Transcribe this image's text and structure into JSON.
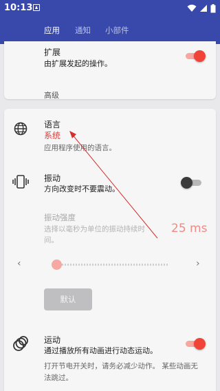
{
  "status_bar": {
    "time": "10:13",
    "icons": [
      "app-notification-icon",
      "wifi-icon",
      "signal-icon",
      "battery-icon"
    ]
  },
  "tabs": [
    {
      "label": "应用",
      "active": true
    },
    {
      "label": "通知",
      "active": false
    },
    {
      "label": "小部件",
      "active": false
    }
  ],
  "extension": {
    "title": "扩展",
    "summary": "由扩展发起的操作。",
    "toggle_on": true
  },
  "section_header": "高级",
  "language": {
    "icon": "globe-icon",
    "title": "语言",
    "value": "系统",
    "summary": "应用程序使用的语言。"
  },
  "vibration": {
    "icon": "vibration-icon",
    "title": "振动",
    "summary": "方向改变时不要震动。",
    "toggle_on": false
  },
  "vibration_strength": {
    "title": "振动强度",
    "summary_line1": "选择以毫秒为单位的振动持续时",
    "summary_line2": "间。",
    "value": "25 ms",
    "slider_level": 0,
    "prev_icon": "chevron-left-icon",
    "next_icon": "chevron-right-icon",
    "default_button": "默认"
  },
  "motion": {
    "icon": "motion-rings-icon",
    "title": "运动",
    "summary": "通过播放所有动画进行动态运动。",
    "toggle_on": true,
    "note_line1": "打开节电开关时，请务必减少动作。 某些动画无",
    "note_line2": "法跳过。"
  },
  "colors": {
    "app_bar": "#3949ab",
    "accent": "#f04438",
    "accent_light": "#f7a6a0",
    "value_red": "#e53935",
    "annotation_arrow": "#d32f2f"
  }
}
